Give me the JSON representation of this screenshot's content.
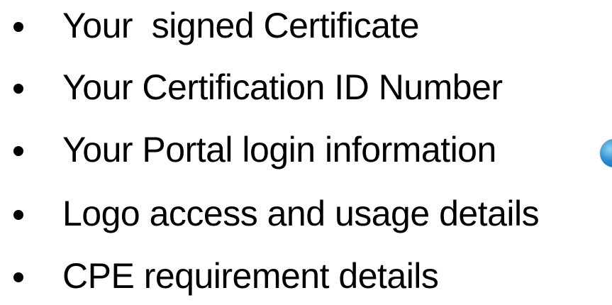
{
  "bullets": [
    {
      "text": "Your  signed Certificate"
    },
    {
      "text": "Your Certification ID Number"
    },
    {
      "text": "Your Portal login information"
    },
    {
      "text": "Logo access and usage details"
    },
    {
      "text": "CPE requirement details"
    }
  ],
  "icons": {
    "portal_icon": "globe-icon"
  },
  "colors": {
    "text": "#000000",
    "background": "#ffffff",
    "icon_accent": "#2a8fd0"
  }
}
